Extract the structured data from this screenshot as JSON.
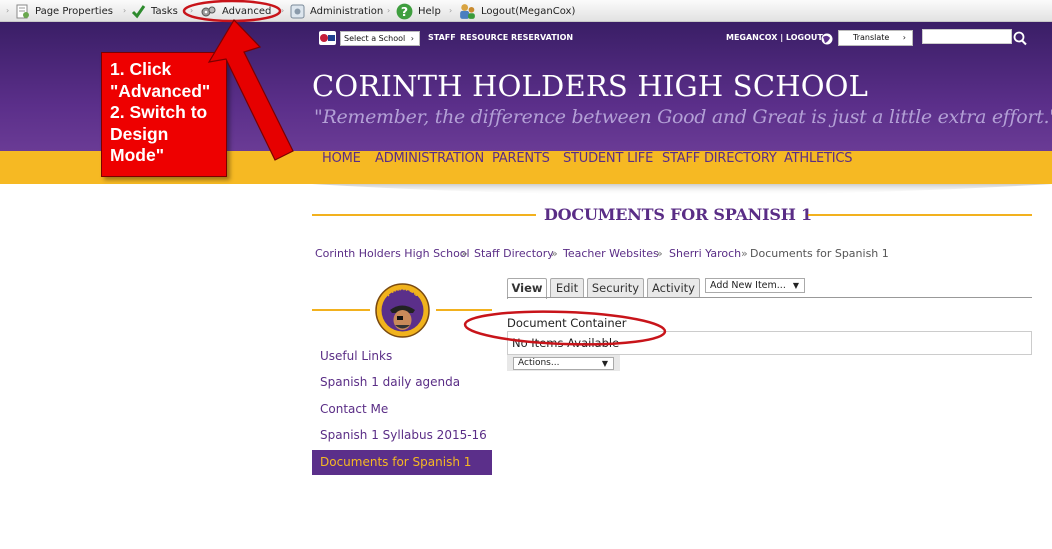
{
  "toolbar": {
    "items": [
      {
        "label": "Page Properties",
        "icon": "page-properties-icon"
      },
      {
        "label": "Tasks",
        "icon": "checkmark-icon"
      },
      {
        "label": "Advanced",
        "icon": "advanced-gears-icon"
      },
      {
        "label": "Administration",
        "icon": "administration-icon"
      },
      {
        "label": "Help",
        "icon": "help-icon"
      },
      {
        "label": "Logout(MeganCox)",
        "icon": "users-logout-icon"
      }
    ]
  },
  "header": {
    "select_school": "Select a School",
    "staff": "STAFF",
    "resource_reservation": "RESOURCE RESERVATION",
    "user_logout": "MEGANCOX | LOGOUT",
    "translate": "Translate",
    "search_value": "",
    "school_name": "CORINTH HOLDERS HIGH SCHOOL",
    "motto": "\"Remember, the difference between Good and Great is just a little extra effort.\""
  },
  "nav": [
    "HOME",
    "ADMINISTRATION",
    "PARENTS",
    "STUDENT LIFE",
    "STAFF DIRECTORY",
    "ATHLETICS"
  ],
  "page": {
    "heading": "DOCUMENTS FOR SPANISH 1",
    "breadcrumb": [
      "Corinth Holders High School",
      "Staff Directory",
      "Teacher Websites",
      "Sherri Yaroch",
      "Documents for Spanish 1"
    ],
    "breadcrumb_sep": "»"
  },
  "tabs": [
    "View",
    "Edit",
    "Security",
    "Activity"
  ],
  "active_tab": "View",
  "add_new_item": "Add New Item...",
  "document_container": "Document Container",
  "no_items": "No Items Available",
  "actions": "Actions...",
  "logo_text": "PIRATES",
  "sidebar": {
    "links": [
      "Useful Links",
      "Spanish 1 daily agenda",
      "Contact Me",
      "Spanish 1 Syllabus 2015-16",
      "Documents for Spanish 1"
    ],
    "active": "Documents for Spanish 1"
  },
  "annotation": {
    "lines": [
      "1. Click",
      "\"Advanced\"",
      "2. Switch to",
      "Design",
      "Mode\""
    ]
  },
  "colors": {
    "purple": "#5b2f8a",
    "gold": "#f6b923",
    "annotation_red": "#e00000"
  }
}
